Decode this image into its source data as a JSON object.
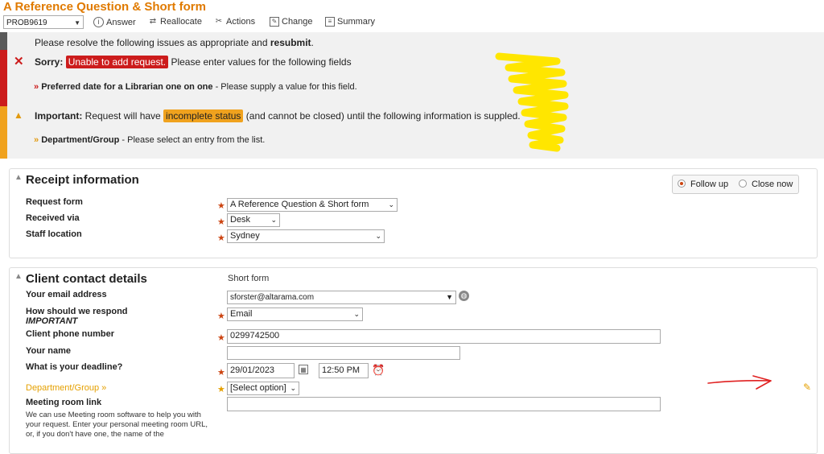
{
  "header": {
    "title": "A Reference Question & Short form",
    "problem_id": "PROB9619",
    "toolbar": [
      {
        "label": "Answer",
        "icon": "info-icon"
      },
      {
        "label": "Reallocate",
        "icon": "reallocate-icon"
      },
      {
        "label": "Actions",
        "icon": "tools-icon"
      },
      {
        "label": "Change",
        "icon": "edit-icon"
      },
      {
        "label": "Summary",
        "icon": "summary-icon"
      }
    ]
  },
  "alerts": {
    "intro_prefix": "Please resolve the following issues as appropriate and ",
    "intro_bold": "resubmit",
    "intro_suffix": ".",
    "sorry_label": "Sorry:",
    "sorry_badge": "Unable to add request.",
    "sorry_text": " Please enter values for the following fields",
    "sorry_item_bold": "Preferred date for a Librarian one on one",
    "sorry_item_text": " - Please supply a value for this field.",
    "important_label": "Important:",
    "important_text1": " Request will have ",
    "important_badge": "incomplete status",
    "important_text2": " (and cannot be closed) until the following information is suppled.",
    "important_item_bold": "Department/Group",
    "important_item_text": " - Please select an entry from the list."
  },
  "receipt": {
    "title": "Receipt information",
    "request_form_label": "Request form",
    "request_form_value": "A Reference Question & Short form",
    "received_via_label": "Received via",
    "received_via_value": "Desk",
    "staff_location_label": "Staff location",
    "staff_location_value": "Sydney",
    "follow_up_label": "Follow up",
    "close_now_label": "Close now"
  },
  "client": {
    "title": "Client contact details",
    "short_form_note": "Short form",
    "email_label": "Your email address",
    "email_value": "sforster@altarama.com",
    "respond_label": "How should we respond",
    "respond_sub": "IMPORTANT",
    "respond_value": "Email",
    "phone_label": "Client phone number",
    "phone_value": "0299742500",
    "name_label": "Your name",
    "name_value": "",
    "deadline_label": "What is your deadline?",
    "deadline_date": "29/01/2023",
    "deadline_time": "12:50 PM",
    "department_label": "Department/Group »",
    "department_value": "[Select option]",
    "meeting_label": "Meeting room link",
    "meeting_help": "We can use Meeting room software to help you with your request. Enter your personal meeting room URL, or, if you don't have one, the name of the"
  },
  "colors": {
    "accent": "#e07a00",
    "error": "#cc1c1c",
    "warning": "#f0a21e"
  }
}
